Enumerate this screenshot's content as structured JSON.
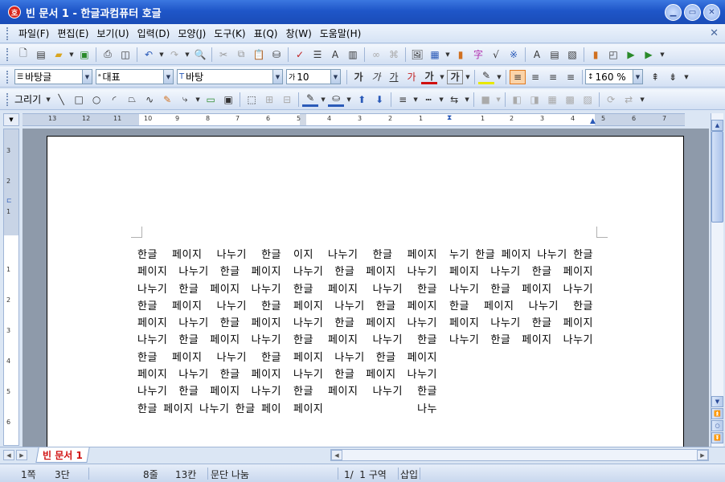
{
  "window": {
    "title": "빈 문서 1 - 한글과컴퓨터 호글",
    "app_icon_text": "호"
  },
  "menu": [
    "파일(F)",
    "편집(E)",
    "보기(U)",
    "입력(D)",
    "모양(J)",
    "도구(K)",
    "표(Q)",
    "창(W)",
    "도움말(H)"
  ],
  "format_bar": {
    "style": "바탕글",
    "font_lang": "대표",
    "font_name": "바탕",
    "font_size": "10",
    "bold": "가",
    "italic": "가",
    "underline": "가",
    "strike": "가",
    "color_char": "가",
    "outline_char": "가",
    "line_spacing": "160 %"
  },
  "draw_bar": {
    "label": "그리기"
  },
  "ruler": {
    "h_ticks": [
      "13",
      "12",
      "11",
      "10",
      "9",
      "8",
      "7",
      "6",
      "5",
      "4",
      "3",
      "2",
      "1",
      "1",
      "2",
      "3",
      "4",
      "5",
      "6",
      "7"
    ],
    "v_ticks": [
      "3",
      "2",
      "1",
      "1",
      "2",
      "3",
      "4",
      "5",
      "6"
    ]
  },
  "document": {
    "columns": [
      "한글 페이지 나누기 한글 페이지 나누기 한글 페이지 나누기 한글 페이지 나누기 한글 페이지 나누기 한글 페이지 나누기 한글 페이지 나누기 한글 페이지 나누기 한글 페이지 나누기 한글 페이지 나누기 한글 페이지 나누기 한글 페이지 나누기 한글 페이지 나누기 한글 페이",
      "이지 나누기 한글 페이지 나누기 한글 페이지 나누기 한글 페이지 나누기 한글 페이지 나누기 한글 페이지 나누기 한글 페이지 나누기 한글 페이지 나누기 한글 페이지 나누기 한글 페이지 나누기 한글 페이지 나누기 한글 페이지 나누기 한글 페이지 나누",
      "누기 한글 페이지 나누기 한글 페이지 나누기 한글 페이지 나누기 한글 페이지 나누기 한글 페이지 나누기 한글 페이지 나누기 한글 페이지 나누기 한글 페이지 나누기"
    ]
  },
  "tabs": {
    "active": "빈 문서 1"
  },
  "status": {
    "page": "1쪽",
    "cols": "3단",
    "line": "8줄",
    "col": "13칸",
    "para": "문단 나눔",
    "section": "1/  1 구역",
    "mode": "삽입"
  }
}
